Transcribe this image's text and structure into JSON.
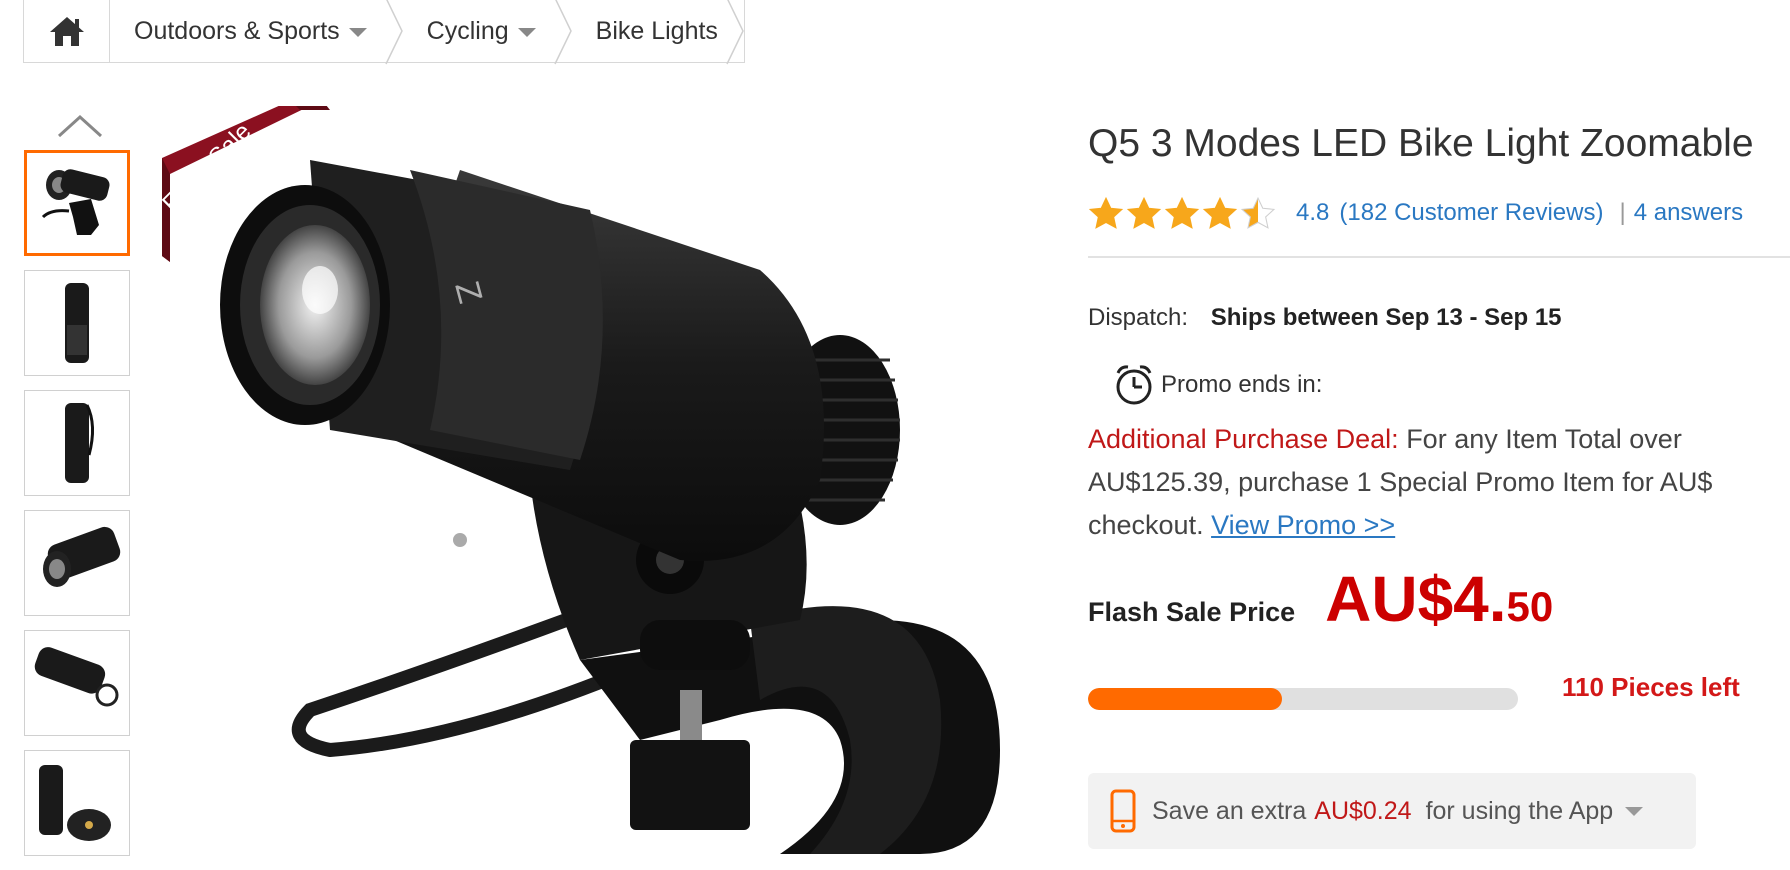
{
  "breadcrumb": {
    "items": [
      {
        "label": "Outdoors & Sports"
      },
      {
        "label": "Cycling"
      },
      {
        "label": "Bike Lights"
      }
    ]
  },
  "product": {
    "ribbon": "Flash Sale",
    "title": "Q5 3 Modes LED Bike Light Zoomable",
    "rating": "4.8",
    "rating_value": 4.5,
    "rating_max": 5,
    "reviews": "(182 Customer Reviews)",
    "answers": "4 answers",
    "dispatch_label": "Dispatch:",
    "dispatch_value": "Ships between Sep 13 - Sep 15",
    "promo_label": "Promo ends in:",
    "deal_label": "Additional Purchase Deal:",
    "deal_text": " For any Item Total over AU$125.39, purchase 1 Special Promo Item for AU$ checkout. ",
    "deal_link": "View Promo >>",
    "flash_label": "Flash Sale Price",
    "price_main": "AU$4.",
    "price_cents": "50",
    "stock_fraction": 0.45,
    "pieces_left": "110 Pieces left",
    "app_prefix": "Save an extra",
    "app_amount": "AU$0.24",
    "app_suffix": "for using the App"
  },
  "colors": {
    "accent": "#ff6a00",
    "price": "#cc0000",
    "link": "#2a78c2",
    "ribbon": "#8b1020",
    "star": "#f7a71b"
  },
  "icons": {
    "home": "home-icon",
    "clock": "alarm-clock-icon",
    "phone": "mobile-phone-icon"
  }
}
